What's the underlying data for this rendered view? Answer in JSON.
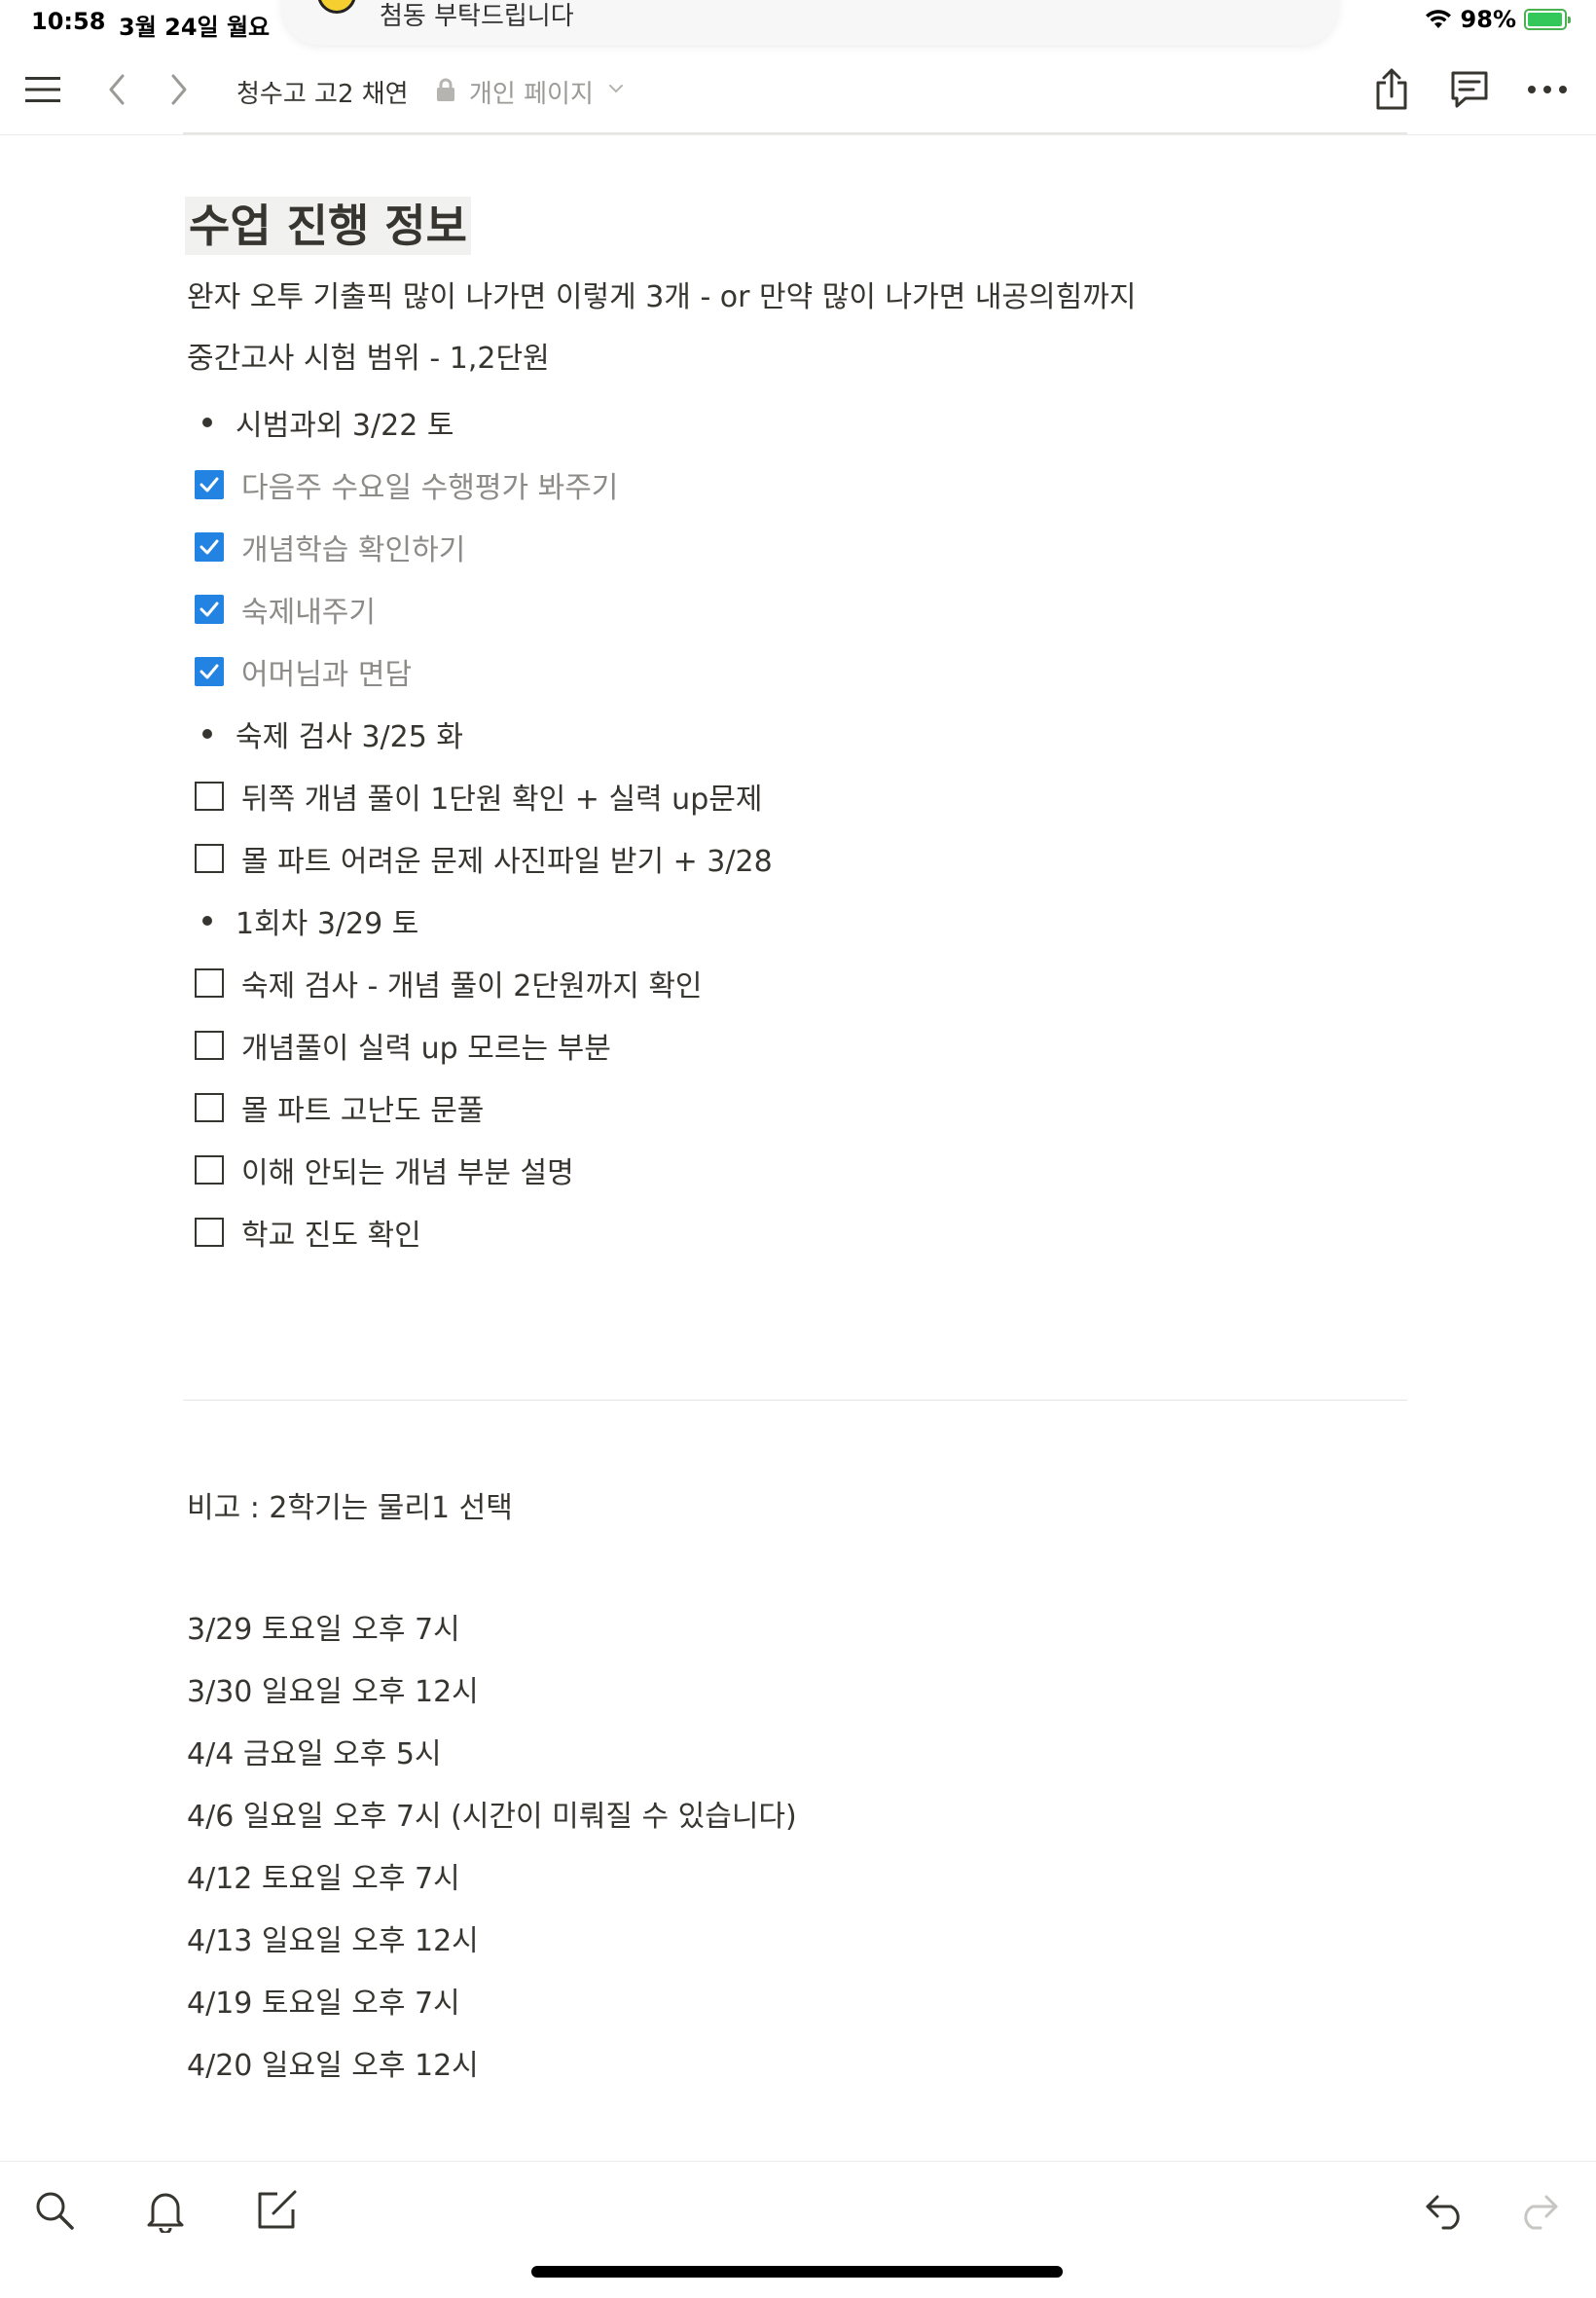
{
  "status": {
    "time": "10:58",
    "date": "3월 24일 월요",
    "battery": "98%",
    "battery_level": 0.98
  },
  "banner": {
    "text": "첨동 부탁드립니다"
  },
  "nav": {
    "breadcrumb": "청수고 고2 채연",
    "privacy": "개인 페이지"
  },
  "page": {
    "title": "수업 진행 정보",
    "intro": [
      "완자 오투 기출픽 많이 나가면 이렇게 3개 - or 만약 많이 나가면 내공의힘까지",
      "중간고사 시험 범위 - 1,2단원"
    ],
    "blocks": [
      {
        "type": "bullet",
        "text": "시범과외 3/22 토"
      },
      {
        "type": "todo",
        "checked": true,
        "text": "다음주 수요일 수행평가 봐주기"
      },
      {
        "type": "todo",
        "checked": true,
        "text": "개념학습 확인하기"
      },
      {
        "type": "todo",
        "checked": true,
        "text": "숙제내주기"
      },
      {
        "type": "todo",
        "checked": true,
        "text": "어머님과 면담"
      },
      {
        "type": "bullet",
        "text": "숙제 검사 3/25 화"
      },
      {
        "type": "todo",
        "checked": false,
        "text": "뒤쪽 개념 풀이 1단원 확인 + 실력 up문제"
      },
      {
        "type": "todo",
        "checked": false,
        "text": "몰 파트 어려운 문제 사진파일 받기 + 3/28"
      },
      {
        "type": "bullet",
        "text": "1회차 3/29 토"
      },
      {
        "type": "todo",
        "checked": false,
        "text": "숙제 검사 - 개념 풀이 2단원까지 확인"
      },
      {
        "type": "todo",
        "checked": false,
        "text": "개념풀이 실력 up 모르는 부분"
      },
      {
        "type": "todo",
        "checked": false,
        "text": "몰 파트 고난도 문풀"
      },
      {
        "type": "todo",
        "checked": false,
        "text": "이해 안되는 개념 부분 설명"
      },
      {
        "type": "todo",
        "checked": false,
        "text": "학교 진도 확인"
      }
    ],
    "note": "비고 : 2학기는 물리1 선택",
    "schedule": [
      "3/29 토요일 오후 7시",
      "3/30 일요일 오후 12시",
      "4/4 금요일 오후 5시",
      "4/6 일요일 오후 7시 (시간이 미뤄질 수 있습니다)",
      "4/12 토요일 오후 7시",
      "4/13 일요일 오후 12시",
      "4/19 토요일 오후 7시",
      "4/20 일요일 오후 12시"
    ]
  },
  "colors": {
    "text": "#37352f",
    "muted": "#9b9a97",
    "checkbox": "#2383e2",
    "battery": "#34c759"
  }
}
